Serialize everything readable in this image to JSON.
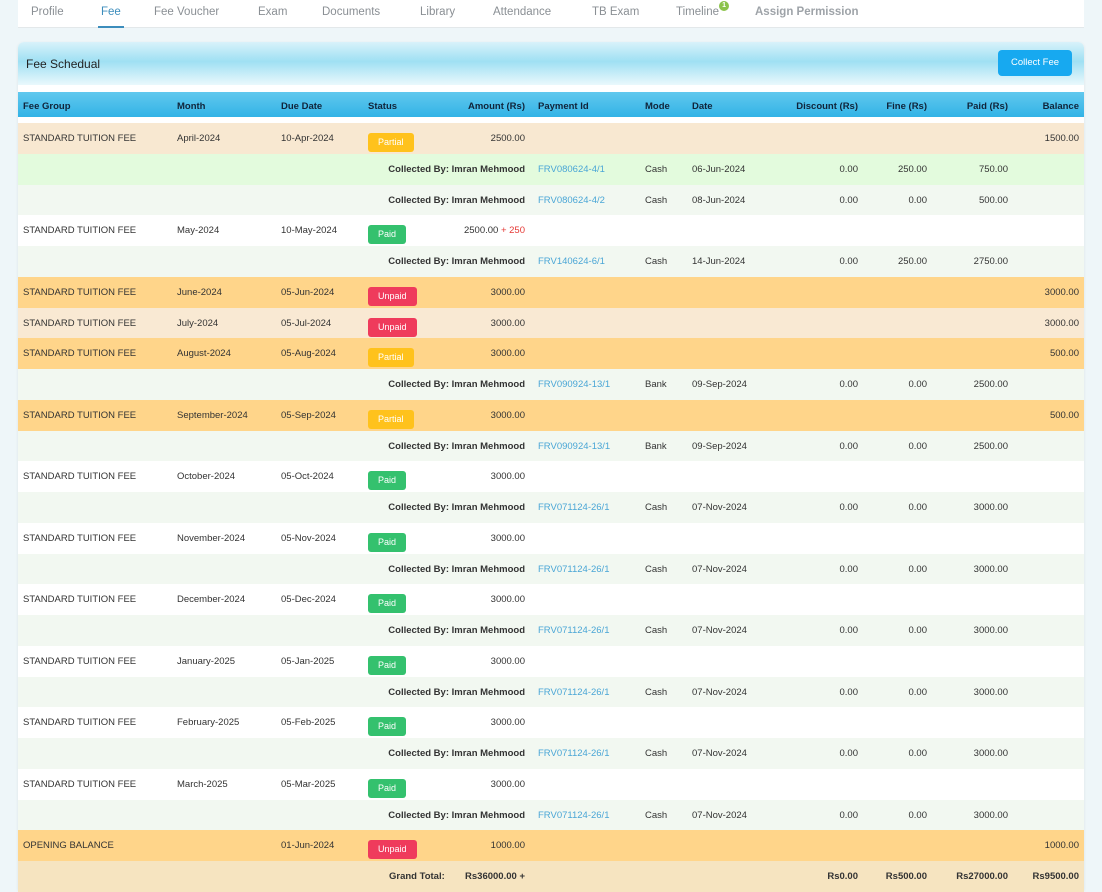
{
  "tabs": [
    {
      "label": "Profile",
      "active": false,
      "bold": false
    },
    {
      "label": "Fee",
      "active": true,
      "bold": false
    },
    {
      "label": "Fee Voucher",
      "active": false,
      "bold": false
    },
    {
      "label": "Exam",
      "active": false,
      "bold": false
    },
    {
      "label": "Documents",
      "active": false,
      "bold": false
    },
    {
      "label": "Library",
      "active": false,
      "bold": false
    },
    {
      "label": "Attendance",
      "active": false,
      "bold": false
    },
    {
      "label": "TB Exam",
      "active": false,
      "bold": false
    },
    {
      "label": "Timeline",
      "active": false,
      "bold": false,
      "badge": "1"
    },
    {
      "label": "Assign Permission",
      "active": false,
      "bold": true
    }
  ],
  "card": {
    "title": "Fee Schedual",
    "collect_label": "Collect Fee"
  },
  "columns": [
    "Fee Group",
    "Month",
    "Due Date",
    "Status",
    "Amount (Rs)",
    "Payment Id",
    "Mode",
    "Date",
    "Discount (Rs)",
    "Fine (Rs)",
    "Paid (Rs)",
    "Balance"
  ],
  "colors": {
    "partial_bg": "#f8e8d1",
    "collected_green": "#e3fbdd",
    "collected_light": "#f2f8f1",
    "white": "#ffffff",
    "orange": "#ffd58a",
    "unpaid_light": "#f9e9d3",
    "total": "#f6e4c0"
  },
  "rows": [
    {
      "type": "fee",
      "bg": "#f8e8d1",
      "group": "STANDARD TUITION FEE",
      "month": "April-2024",
      "due": "10-Apr-2024",
      "status": "Partial",
      "amount": "2500.00",
      "extra": "",
      "balance": "1500.00"
    },
    {
      "type": "collected",
      "bg": "#e3fbdd",
      "by": "Collected By: Imran Mehmood",
      "pid": "FRV080624-4/1",
      "mode": "Cash",
      "date": "06-Jun-2024",
      "discount": "0.00",
      "fine": "250.00",
      "paid": "750.00"
    },
    {
      "type": "collected",
      "bg": "#f2f8f1",
      "by": "Collected By: Imran Mehmood",
      "pid": "FRV080624-4/2",
      "mode": "Cash",
      "date": "08-Jun-2024",
      "discount": "0.00",
      "fine": "0.00",
      "paid": "500.00"
    },
    {
      "type": "fee",
      "bg": "#ffffff",
      "group": "STANDARD TUITION FEE",
      "month": "May-2024",
      "due": "10-May-2024",
      "status": "Paid",
      "amount": "2500.00",
      "extra": " + 250",
      "balance": ""
    },
    {
      "type": "collected",
      "bg": "#f2f8f1",
      "by": "Collected By: Imran Mehmood",
      "pid": "FRV140624-6/1",
      "mode": "Cash",
      "date": "14-Jun-2024",
      "discount": "0.00",
      "fine": "250.00",
      "paid": "2750.00"
    },
    {
      "type": "fee",
      "bg": "#ffd58a",
      "group": "STANDARD TUITION FEE",
      "month": "June-2024",
      "due": "05-Jun-2024",
      "status": "Unpaid",
      "amount": "3000.00",
      "extra": "",
      "balance": "3000.00"
    },
    {
      "type": "fee",
      "bg": "#f9e9d3",
      "group": "STANDARD TUITION FEE",
      "month": "July-2024",
      "due": "05-Jul-2024",
      "status": "Unpaid",
      "amount": "3000.00",
      "extra": "",
      "balance": "3000.00"
    },
    {
      "type": "fee",
      "bg": "#ffd58a",
      "group": "STANDARD TUITION FEE",
      "month": "August-2024",
      "due": "05-Aug-2024",
      "status": "Partial",
      "amount": "3000.00",
      "extra": "",
      "balance": "500.00"
    },
    {
      "type": "collected",
      "bg": "#f2f8f1",
      "by": "Collected By: Imran Mehmood",
      "pid": "FRV090924-13/1",
      "mode": "Bank",
      "date": "09-Sep-2024",
      "discount": "0.00",
      "fine": "0.00",
      "paid": "2500.00"
    },
    {
      "type": "fee",
      "bg": "#ffd58a",
      "group": "STANDARD TUITION FEE",
      "month": "September-2024",
      "due": "05-Sep-2024",
      "status": "Partial",
      "amount": "3000.00",
      "extra": "",
      "balance": "500.00"
    },
    {
      "type": "collected",
      "bg": "#f2f8f1",
      "by": "Collected By: Imran Mehmood",
      "pid": "FRV090924-13/1",
      "mode": "Bank",
      "date": "09-Sep-2024",
      "discount": "0.00",
      "fine": "0.00",
      "paid": "2500.00"
    },
    {
      "type": "fee",
      "bg": "#ffffff",
      "group": "STANDARD TUITION FEE",
      "month": "October-2024",
      "due": "05-Oct-2024",
      "status": "Paid",
      "amount": "3000.00",
      "extra": "",
      "balance": ""
    },
    {
      "type": "collected",
      "bg": "#f2f8f1",
      "by": "Collected By: Imran Mehmood",
      "pid": "FRV071124-26/1",
      "mode": "Cash",
      "date": "07-Nov-2024",
      "discount": "0.00",
      "fine": "0.00",
      "paid": "3000.00"
    },
    {
      "type": "fee",
      "bg": "#ffffff",
      "group": "STANDARD TUITION FEE",
      "month": "November-2024",
      "due": "05-Nov-2024",
      "status": "Paid",
      "amount": "3000.00",
      "extra": "",
      "balance": ""
    },
    {
      "type": "collected",
      "bg": "#f2f8f1",
      "by": "Collected By: Imran Mehmood",
      "pid": "FRV071124-26/1",
      "mode": "Cash",
      "date": "07-Nov-2024",
      "discount": "0.00",
      "fine": "0.00",
      "paid": "3000.00"
    },
    {
      "type": "fee",
      "bg": "#ffffff",
      "group": "STANDARD TUITION FEE",
      "month": "December-2024",
      "due": "05-Dec-2024",
      "status": "Paid",
      "amount": "3000.00",
      "extra": "",
      "balance": ""
    },
    {
      "type": "collected",
      "bg": "#f2f8f1",
      "by": "Collected By: Imran Mehmood",
      "pid": "FRV071124-26/1",
      "mode": "Cash",
      "date": "07-Nov-2024",
      "discount": "0.00",
      "fine": "0.00",
      "paid": "3000.00"
    },
    {
      "type": "fee",
      "bg": "#ffffff",
      "group": "STANDARD TUITION FEE",
      "month": "January-2025",
      "due": "05-Jan-2025",
      "status": "Paid",
      "amount": "3000.00",
      "extra": "",
      "balance": ""
    },
    {
      "type": "collected",
      "bg": "#f2f8f1",
      "by": "Collected By: Imran Mehmood",
      "pid": "FRV071124-26/1",
      "mode": "Cash",
      "date": "07-Nov-2024",
      "discount": "0.00",
      "fine": "0.00",
      "paid": "3000.00"
    },
    {
      "type": "fee",
      "bg": "#ffffff",
      "group": "STANDARD TUITION FEE",
      "month": "February-2025",
      "due": "05-Feb-2025",
      "status": "Paid",
      "amount": "3000.00",
      "extra": "",
      "balance": ""
    },
    {
      "type": "collected",
      "bg": "#f2f8f1",
      "by": "Collected By: Imran Mehmood",
      "pid": "FRV071124-26/1",
      "mode": "Cash",
      "date": "07-Nov-2024",
      "discount": "0.00",
      "fine": "0.00",
      "paid": "3000.00"
    },
    {
      "type": "fee",
      "bg": "#ffffff",
      "group": "STANDARD TUITION FEE",
      "month": "March-2025",
      "due": "05-Mar-2025",
      "status": "Paid",
      "amount": "3000.00",
      "extra": "",
      "balance": ""
    },
    {
      "type": "collected",
      "bg": "#f2f8f1",
      "by": "Collected By: Imran Mehmood",
      "pid": "FRV071124-26/1",
      "mode": "Cash",
      "date": "07-Nov-2024",
      "discount": "0.00",
      "fine": "0.00",
      "paid": "3000.00"
    },
    {
      "type": "fee",
      "bg": "#ffd58a",
      "group": "OPENING BALANCE",
      "month": "",
      "due": "01-Jun-2024",
      "status": "Unpaid",
      "amount": "1000.00",
      "extra": "",
      "balance": "1000.00"
    },
    {
      "type": "total",
      "bg": "#f6e4c0",
      "label": "Grand Total:",
      "amount": "Rs36000.00 +",
      "discount": "Rs0.00",
      "fine": "Rs500.00",
      "paid": "Rs27000.00",
      "balance": "Rs9500.00"
    }
  ]
}
